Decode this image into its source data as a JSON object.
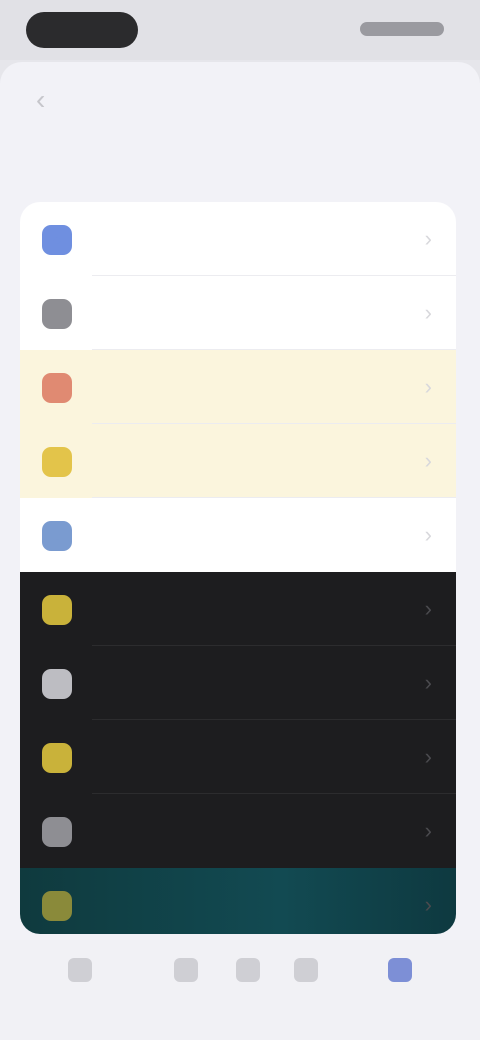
{
  "nav": {
    "back_glyph": "‹",
    "title": ""
  },
  "section": {
    "header": ""
  },
  "rows": [
    {
      "label": "",
      "icon": "globe-icon",
      "glyph": "●",
      "icon_color": "#6f8fe0"
    },
    {
      "label": "",
      "icon": "gear-icon",
      "glyph": "●",
      "icon_color": "#8e8e93"
    },
    {
      "label": "",
      "icon": "bell-icon",
      "glyph": "●",
      "icon_color": "#e08a72"
    },
    {
      "label": "",
      "icon": "star-icon",
      "glyph": "●",
      "icon_color": "#e3c44a"
    },
    {
      "label": "",
      "icon": "info-icon",
      "glyph": "●",
      "icon_color": "#7a9bd0"
    },
    {
      "label": "",
      "icon": "sun-icon",
      "glyph": "●",
      "icon_color": "#c9b23a"
    },
    {
      "label": "",
      "icon": "moon-icon",
      "glyph": "●",
      "icon_color": "#bdbdc2"
    },
    {
      "label": "",
      "icon": "bolt-icon",
      "glyph": "●",
      "icon_color": "#c9b23a"
    },
    {
      "label": "",
      "icon": "lock-icon",
      "glyph": "●",
      "icon_color": "#8e8e93"
    },
    {
      "label": "",
      "icon": "leaf-icon",
      "glyph": "●",
      "icon_color": "#8a8a3a"
    }
  ],
  "chevron_glyph": "›",
  "tabs": [
    {
      "label": "",
      "icon": "home-icon"
    },
    {
      "label": "",
      "icon": "grid-icon"
    },
    {
      "label": "",
      "icon": "search-icon"
    },
    {
      "label": "",
      "icon": "heart-icon"
    },
    {
      "label": "",
      "icon": "settings-icon",
      "active": true
    }
  ],
  "colors": {
    "accent": "#7d8fd6",
    "sheet_bg": "#f2f2f7",
    "dark_row_bg": "#1d1d1f",
    "teal_row_bg": "#124a52"
  }
}
